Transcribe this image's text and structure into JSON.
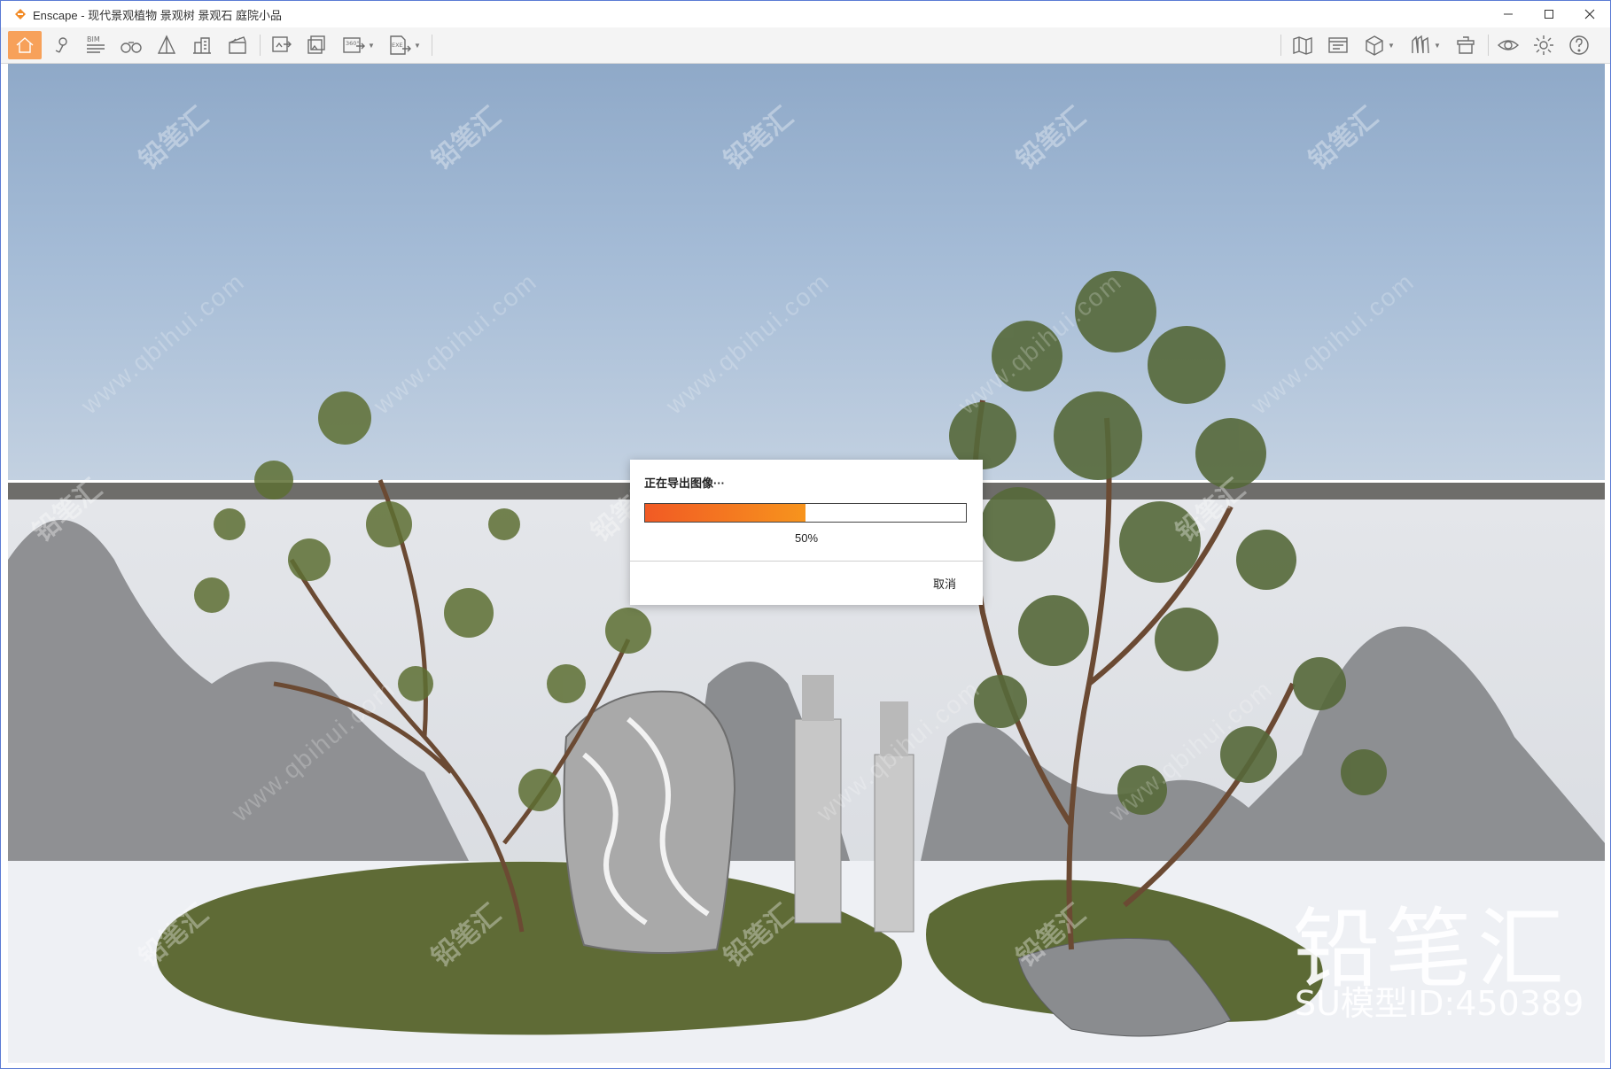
{
  "window": {
    "app_name": "Enscape",
    "title": "Enscape - 现代景观植物 景观树 景观石 庭院小品"
  },
  "toolbar": {
    "left_icons": [
      "home-icon",
      "location-pin-icon",
      "bim-icon",
      "binoculars-icon",
      "perspective-icon",
      "buildings-icon",
      "clapperboard-icon",
      "render-image-icon",
      "batch-render-icon",
      "panorama-360-icon",
      "export-exe-icon"
    ],
    "bim_label": "BIM",
    "panorama_label": "360°",
    "exe_label": "EXE",
    "right_icons": [
      "map-icon",
      "view-management-icon",
      "cube-icon",
      "asset-library-icon",
      "material-icon",
      "eye-icon",
      "gear-icon",
      "help-icon"
    ]
  },
  "dialog": {
    "title": "正在导出图像···",
    "progress_value": 0.5,
    "progress_text": "50%",
    "cancel_label": "取消"
  },
  "overlay": {
    "watermark_text": "铅笔汇",
    "watermark_url": "www.qbihui.com",
    "brand_big": "铅笔汇",
    "brand_id": "SU模型ID:450389"
  },
  "colors": {
    "accent": "#f7a15a",
    "progress_start": "#f15a24",
    "progress_end": "#f7941d"
  }
}
